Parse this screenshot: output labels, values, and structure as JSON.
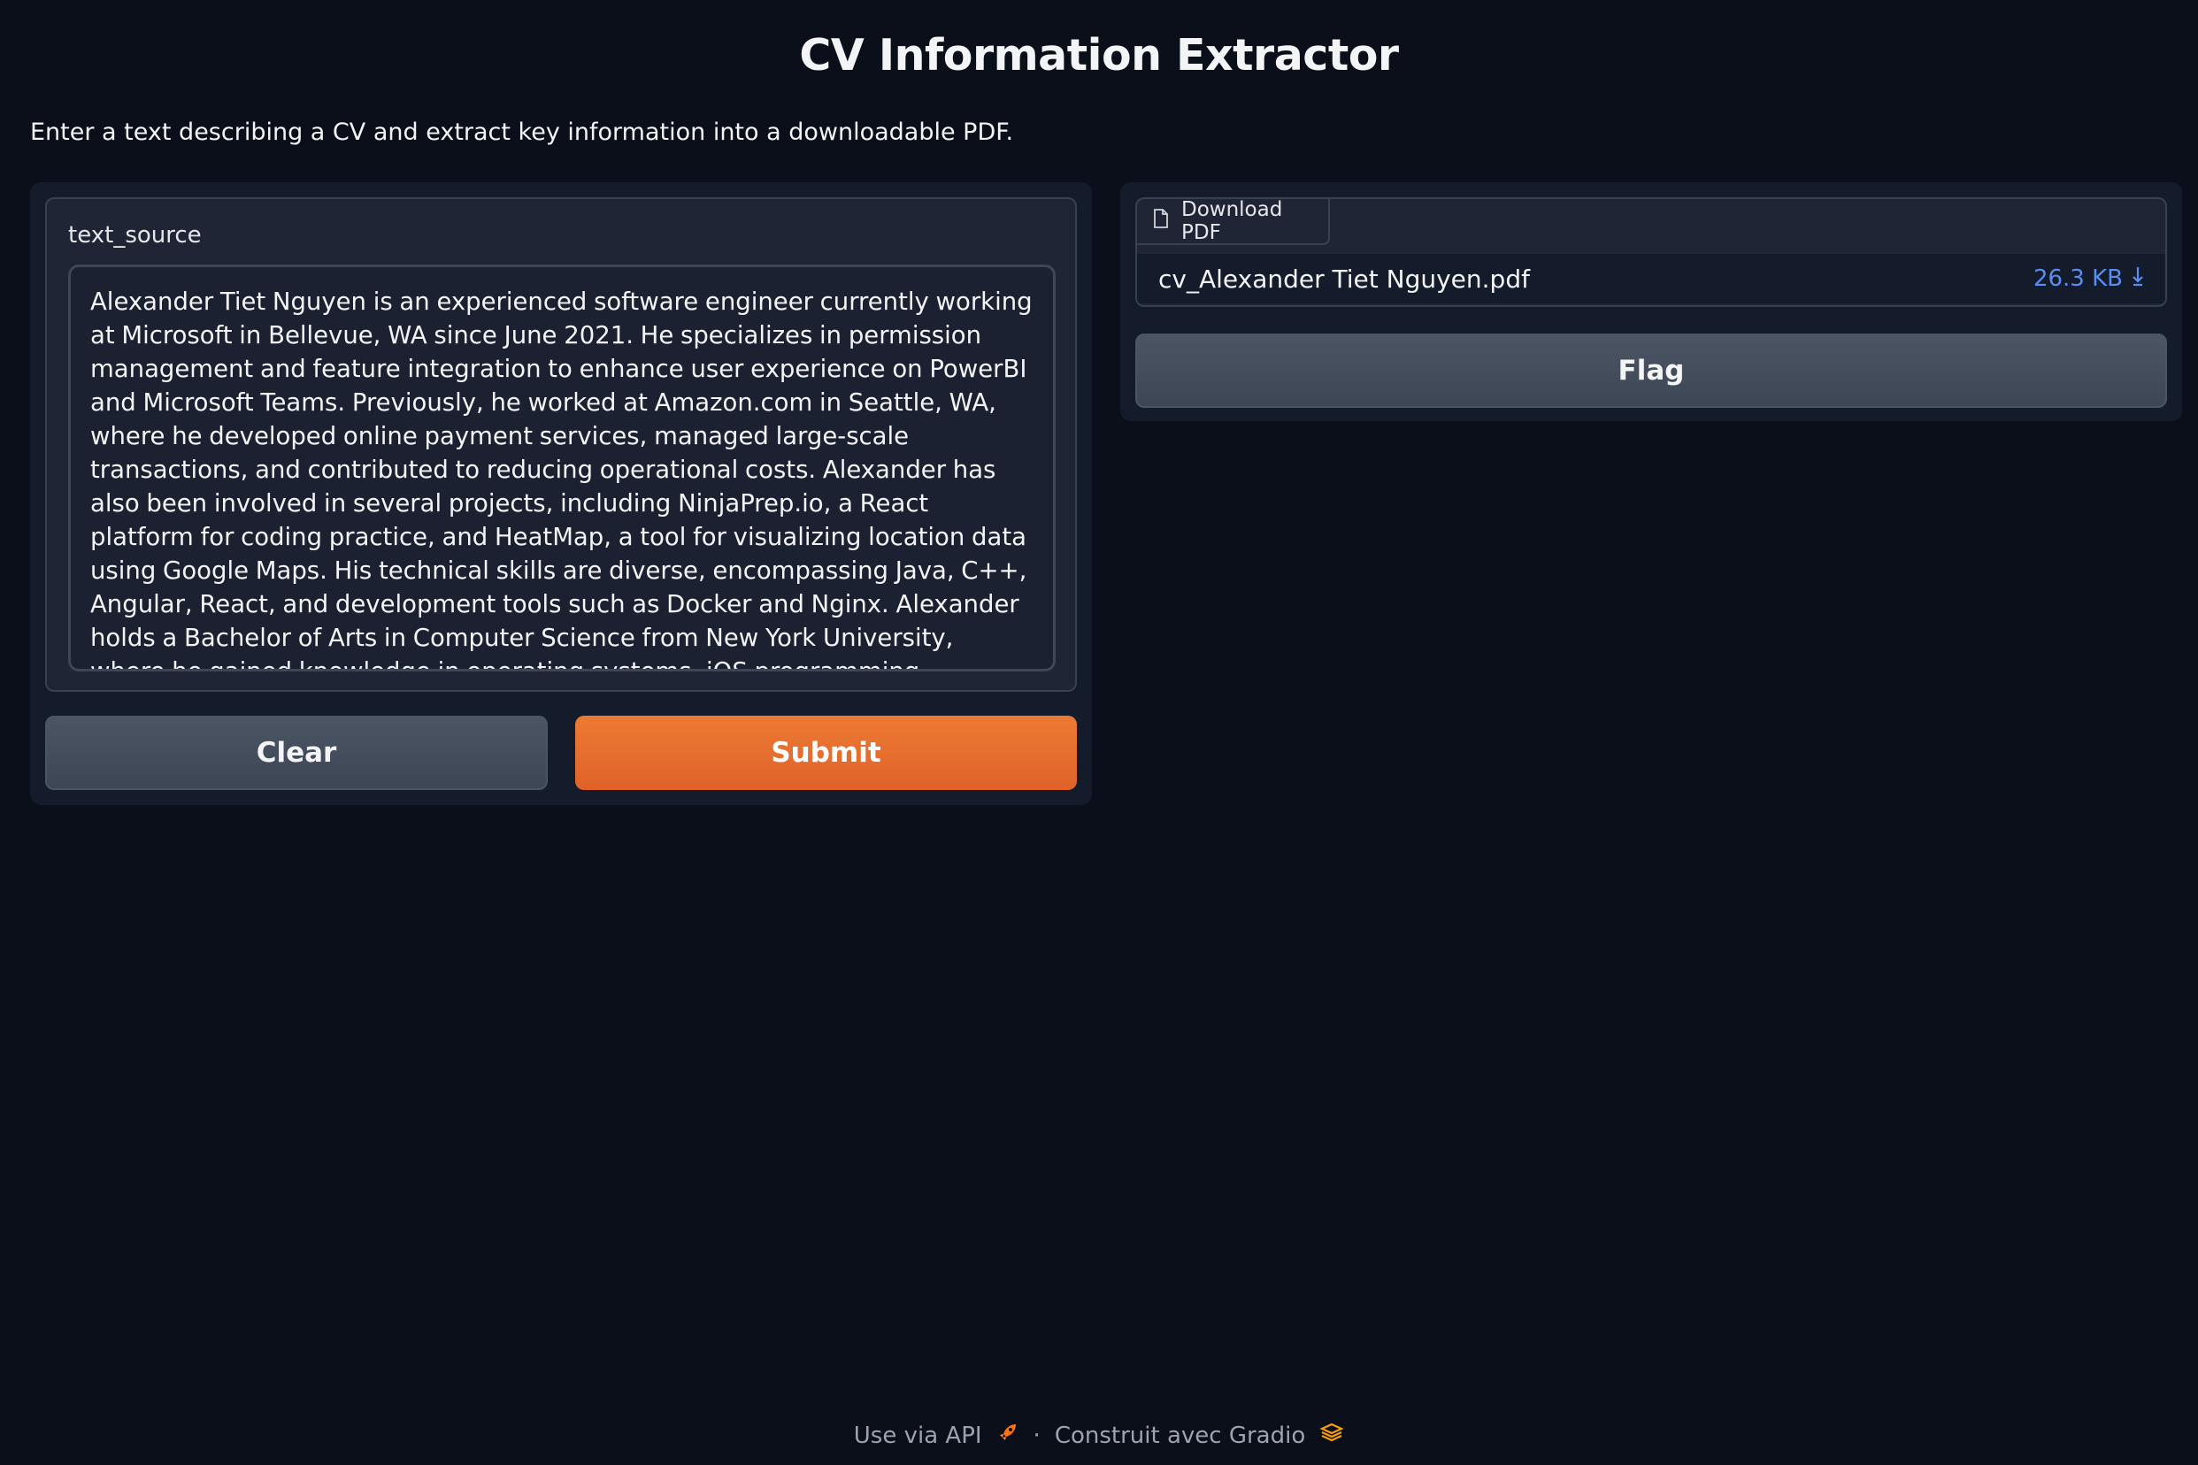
{
  "app": {
    "title": "CV Information Extractor",
    "description": "Enter a text describing a CV and extract key information into a downloadable PDF."
  },
  "input": {
    "label": "text_source",
    "value": "Alexander Tiet Nguyen is an experienced software engineer currently working at Microsoft in Bellevue, WA since June 2021. He specializes in permission management and feature integration to enhance user experience on PowerBI and Microsoft Teams. Previously, he worked at Amazon.com in Seattle, WA, where he developed online payment services, managed large-scale transactions, and contributed to reducing operational costs. Alexander has also been involved in several projects, including NinjaPrep.io, a React platform for coding practice, and HeatMap, a tool for visualizing location data using Google Maps. His technical skills are diverse, encompassing Java, C++, Angular, React, and development tools such as Docker and Nginx. Alexander holds a Bachelor of Arts in Computer Science from New York University, where he gained knowledge in operating systems, iOS programming, cybersecurity, and algorithms."
  },
  "buttons": {
    "clear": "Clear",
    "submit": "Submit",
    "flag": "Flag"
  },
  "output": {
    "label": "Download PDF",
    "file_name": "cv_Alexander Tiet Nguyen.pdf",
    "file_size": "26.3 KB"
  },
  "footer": {
    "api": "Use via API",
    "separator": "·",
    "built_with": "Construit avec Gradio"
  },
  "colors": {
    "background": "#0b0f19",
    "panel": "#141b2a",
    "primary": "#e8702e",
    "link": "#5b8def"
  },
  "icons": [
    "file-icon",
    "download-icon",
    "rocket-icon",
    "gradio-logo-icon"
  ]
}
